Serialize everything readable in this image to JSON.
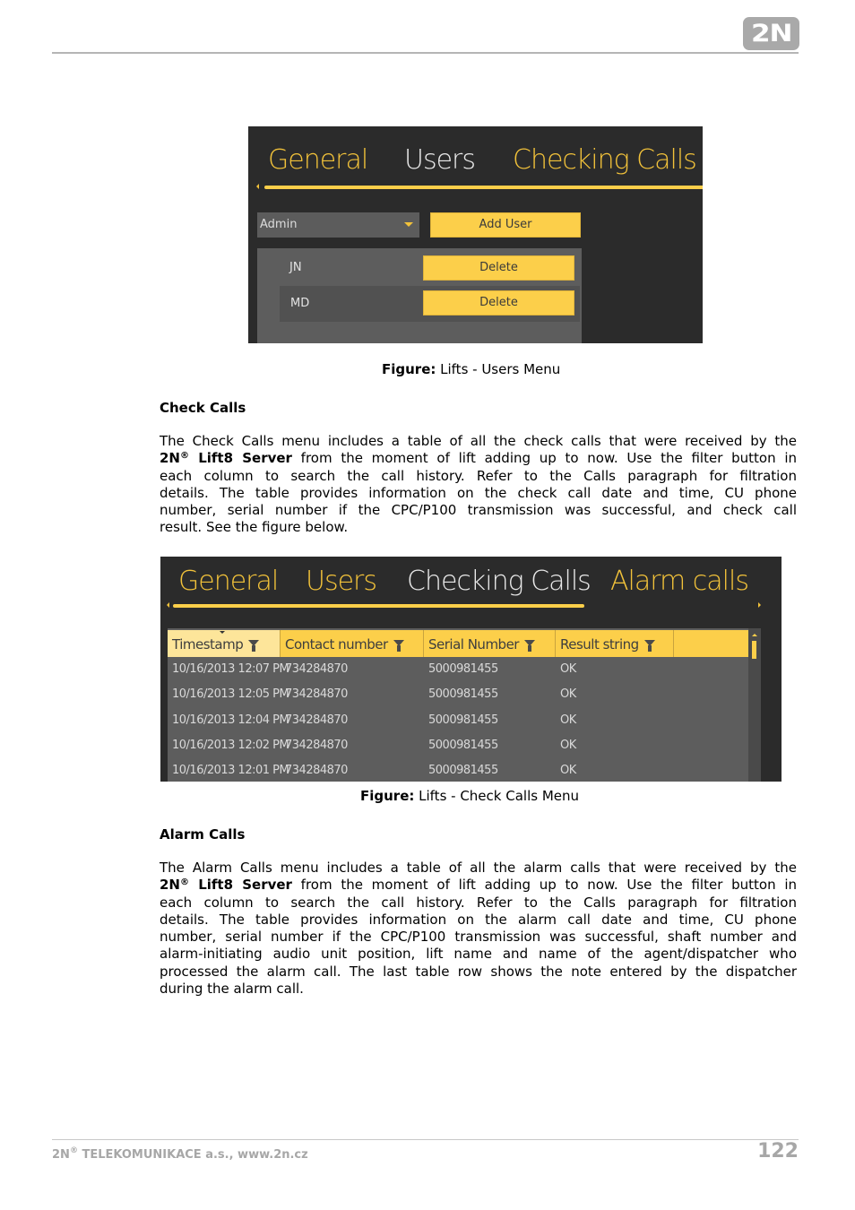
{
  "header": {
    "logo_text": "2N"
  },
  "figure_users": {
    "tabs": [
      {
        "label": "General",
        "active": false
      },
      {
        "label": "Users",
        "active": true
      },
      {
        "label": "Checking Calls",
        "active": false
      }
    ],
    "role_dropdown": {
      "value": "Admin"
    },
    "add_user_label": "Add User",
    "users": [
      {
        "name": "JN",
        "delete_label": "Delete"
      },
      {
        "name": "MD",
        "delete_label": "Delete"
      }
    ],
    "caption_label": "Figure:",
    "caption_text": " Lifts - Users Menu"
  },
  "check_calls": {
    "heading": "Check Calls",
    "paragraph": {
      "line1": "The Check Calls menu includes a table of all the check calls that were received by the",
      "brand": "2N",
      "reg": "®",
      "product": " Lift8 Server",
      "line2_rest": " from the moment of lift adding up to now. Use the filter button in",
      "line3": "each column to search the call history. Refer to the Calls paragraph for filtration",
      "line4": "details. The table provides information on the check call date and time, CU phone",
      "line5": "number, serial number if the CPC/P100 transmission was successful, and check call",
      "line6": "result. See the figure below."
    }
  },
  "figure_check_calls": {
    "tabs": [
      {
        "label": "General",
        "active": false
      },
      {
        "label": "Users",
        "active": false
      },
      {
        "label": "Checking Calls",
        "active": true
      },
      {
        "label": "Alarm calls",
        "active": false
      }
    ],
    "columns": [
      "Timestamp",
      "Contact number",
      "Serial Number",
      "Result string"
    ],
    "sorted_column": "Timestamp",
    "rows": [
      {
        "timestamp": "10/16/2013 12:07 PM",
        "contact": "734284870",
        "serial": "5000981455",
        "result": "OK"
      },
      {
        "timestamp": "10/16/2013 12:05 PM",
        "contact": "734284870",
        "serial": "5000981455",
        "result": "OK"
      },
      {
        "timestamp": "10/16/2013 12:04 PM",
        "contact": "734284870",
        "serial": "5000981455",
        "result": "OK"
      },
      {
        "timestamp": "10/16/2013 12:02 PM",
        "contact": "734284870",
        "serial": "5000981455",
        "result": "OK"
      },
      {
        "timestamp": "10/16/2013 12:01 PM",
        "contact": "734284870",
        "serial": "5000981455",
        "result": "OK"
      }
    ],
    "caption_label": "Figure:",
    "caption_text": " Lifts - Check Calls Menu"
  },
  "alarm_calls": {
    "heading": "Alarm Calls",
    "paragraph": {
      "line1": "The Alarm Calls menu includes a table of all the alarm calls that were received by the",
      "brand": "2N",
      "reg": "®",
      "product": " Lift8 Server",
      "line2_rest": " from the moment of lift adding up to now. Use the filter button in",
      "line3": "each column to search the call history. Refer to the Calls paragraph for filtration",
      "line4": "details. The table provides information on the alarm call date and time, CU phone",
      "line5": "number, serial number if the CPC/P100 transmission was successful, shaft number and",
      "line6": "alarm-initiating audio unit position, lift name and name of the agent/dispatcher who",
      "line7": "processed the alarm call. The last table row shows the note entered by the dispatcher",
      "line8": "during the alarm call."
    }
  },
  "footer": {
    "company_brand": "2N",
    "reg": "®",
    "company_rest": " TELEKOMUNIKACE a.s., www.2n.cz",
    "page_number": "122"
  },
  "colors": {
    "accent_yellow": "#fccf4a",
    "app_background": "#2b2b2b",
    "panel_gray": "#5d5d5d",
    "footer_gray": "#a7a7a7"
  }
}
